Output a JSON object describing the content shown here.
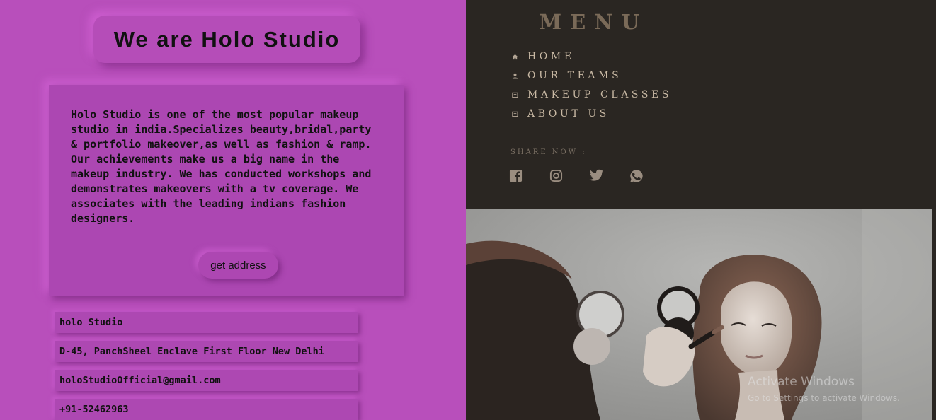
{
  "colors": {
    "left_bg": "#b84fbb",
    "menu_bg": "#2a2622",
    "menu_title": "#7a6a58",
    "nav_text": "#c9b9a4",
    "icon": "#b3a595"
  },
  "left": {
    "title": "We are Holo Studio",
    "about_text": "Holo Studio is one of the most popular makeup studio in india.Specializes beauty,bridal,party & portfolio makeover,as well as fashion & ramp. Our achievements make us a big name in the makeup industry. We has conducted workshops and demonstrates makeovers with a tv coverage. We associates with the leading indians fashion designers.",
    "address_button": "get address",
    "info": {
      "name": "holo Studio",
      "address": "D-45, PanchSheel Enclave First Floor New Delhi",
      "email": "holoStudioOfficial@gmail.com",
      "phone": "+91-52462963"
    }
  },
  "menu": {
    "title": "MENU",
    "items": [
      {
        "label": "HOME",
        "icon": "home-icon"
      },
      {
        "label": "OUR TEAMS",
        "icon": "person-icon"
      },
      {
        "label": "MAKEUP CLASSES",
        "icon": "book-icon"
      },
      {
        "label": "ABOUT US",
        "icon": "book-icon"
      }
    ],
    "share_label": "SHARE NOW :",
    "social": [
      "facebook-icon",
      "instagram-icon",
      "twitter-icon",
      "whatsapp-icon"
    ]
  },
  "watermark": {
    "line1": "Activate Windows",
    "line2": "Go to Settings to activate Windows."
  }
}
